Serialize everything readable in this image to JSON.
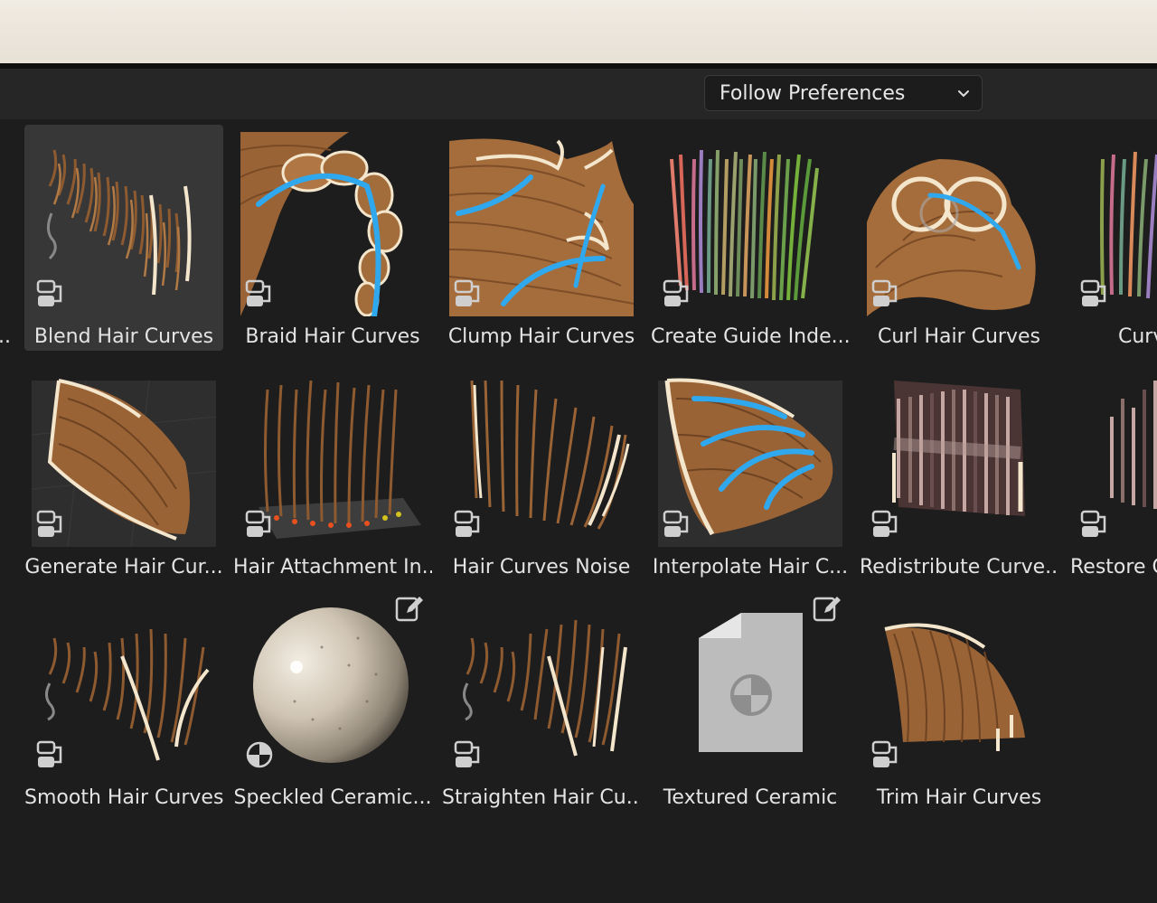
{
  "toolbar": {
    "dropdown_value": "Follow Preferences"
  },
  "assets": [
    {
      "label": "...",
      "thumb": "hair-cut",
      "colorful": false
    },
    {
      "label": "Blend Hair Curves",
      "thumb": "hair",
      "selected": true
    },
    {
      "label": "Braid Hair Curves",
      "thumb": "braid"
    },
    {
      "label": "Clump Hair Curves",
      "thumb": "clump"
    },
    {
      "label": "Create Guide Inde...",
      "thumb": "colorhair"
    },
    {
      "label": "Curl Hair Curves",
      "thumb": "curl"
    },
    {
      "label": "Curv",
      "thumb": "colorhair"
    },
    {
      "label": "Generate Hair Cur...",
      "thumb": "fan"
    },
    {
      "label": "Hair Attachment In...",
      "thumb": "attach"
    },
    {
      "label": "Hair Curves Noise",
      "thumb": "hair"
    },
    {
      "label": "Interpolate Hair C...",
      "thumb": "fanblue"
    },
    {
      "label": "Redistribute Curve...",
      "thumb": "block"
    },
    {
      "label": "Restore C",
      "thumb": "block"
    },
    {
      "label": "Smooth Hair Curves",
      "thumb": "hair"
    },
    {
      "label": "Speckled Ceramic...",
      "thumb": "sphere"
    },
    {
      "label": "Straighten Hair Cu...",
      "thumb": "hair"
    },
    {
      "label": "Textured Ceramic",
      "thumb": "doc"
    },
    {
      "label": "Trim Hair Curves",
      "thumb": "trim"
    }
  ],
  "colors": {
    "hair": "#9a6336",
    "hair_light": "#c48a55",
    "guide_blue": "#2fa8ee",
    "outline": "#f3e6cc"
  },
  "icons": {
    "node_group": "node-group-icon",
    "material": "material-icon",
    "edit": "edit-icon",
    "chevron": "chevron-down-icon"
  }
}
